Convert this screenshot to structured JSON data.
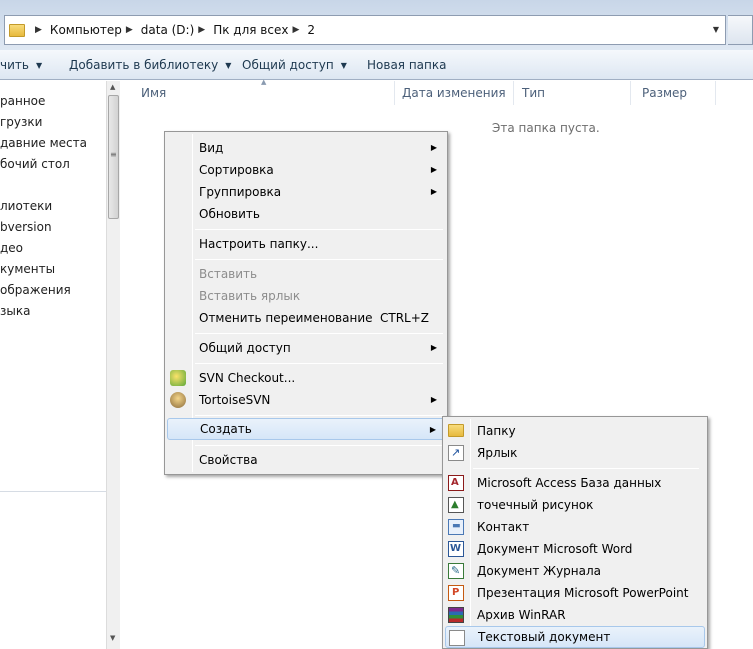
{
  "address": {
    "crumbs": [
      "Компьютер",
      "data (D:)",
      "Пк для всех",
      "2"
    ]
  },
  "toolbar": {
    "items": [
      "чить",
      "Добавить в библиотеку",
      "Общий доступ",
      "Новая папка"
    ]
  },
  "nav": {
    "items": [
      "ранное",
      "грузки",
      "давние места",
      "бочий стол",
      "лиотеки",
      "bversion",
      "део",
      "кументы",
      "ображения",
      "зыка"
    ]
  },
  "columns": [
    "Имя",
    "Дата изменения",
    "Тип",
    "Размер"
  ],
  "empty_message": "Эта папка пуста.",
  "context_menu": {
    "items": [
      {
        "label": "Вид",
        "submenu": true
      },
      {
        "label": "Сортировка",
        "submenu": true
      },
      {
        "label": "Группировка",
        "submenu": true
      },
      {
        "label": "Обновить"
      },
      {
        "label": "Настроить папку..."
      },
      {
        "label": "Вставить",
        "disabled": true
      },
      {
        "label": "Вставить ярлык",
        "disabled": true
      },
      {
        "label": "Отменить переименование",
        "shortcut": "CTRL+Z"
      },
      {
        "label": "Общий доступ",
        "submenu": true
      },
      {
        "label": "SVN Checkout...",
        "icon": "svn-checkout-icon"
      },
      {
        "label": "TortoiseSVN",
        "icon": "tortoisesvn-icon",
        "submenu": true
      },
      {
        "label": "Создать",
        "submenu": true,
        "highlighted": true
      },
      {
        "label": "Свойства"
      }
    ]
  },
  "create_submenu": {
    "items": [
      {
        "label": "Папку",
        "icon": "folder-icon"
      },
      {
        "label": "Ярлык",
        "icon": "shortcut-icon"
      },
      {
        "label": "Microsoft Access База данных",
        "icon": "access-icon"
      },
      {
        "label": "точечный рисунок",
        "icon": "bitmap-icon"
      },
      {
        "label": "Контакт",
        "icon": "contact-icon"
      },
      {
        "label": "Документ Microsoft Word",
        "icon": "word-icon"
      },
      {
        "label": "Документ Журнала",
        "icon": "journal-icon"
      },
      {
        "label": "Презентация Microsoft PowerPoint",
        "icon": "powerpoint-icon"
      },
      {
        "label": "Архив WinRAR",
        "icon": "winrar-icon"
      },
      {
        "label": "Текстовый документ",
        "icon": "text-document-icon",
        "highlighted": true
      }
    ]
  }
}
